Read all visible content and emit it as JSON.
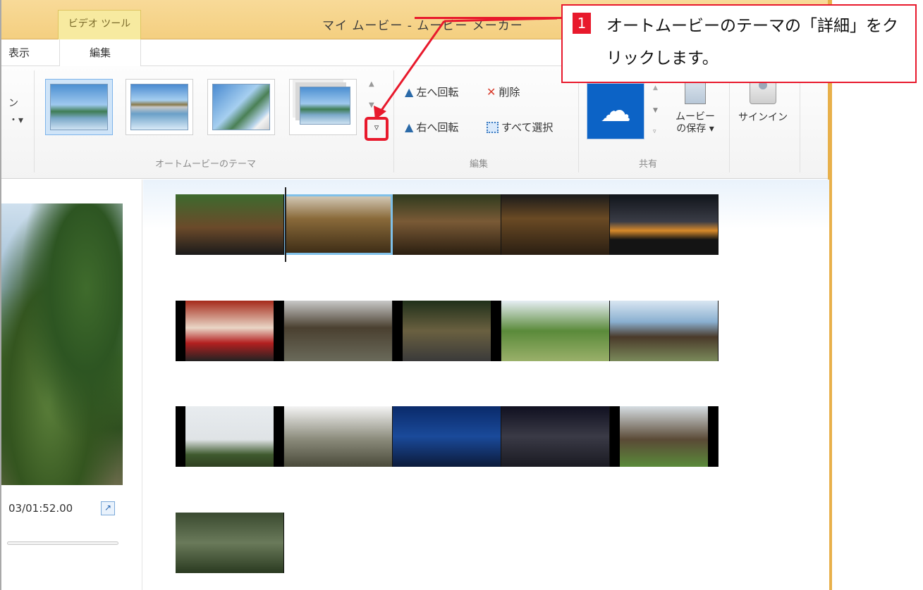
{
  "titlebar": {
    "contextual_tab": "ビデオ ツール",
    "title": "マイ ムービー - ムービー メーカー"
  },
  "tabs": {
    "view": "表示",
    "edit": "編集"
  },
  "ribbon": {
    "left_stub_top": "ン",
    "left_stub_bottom": "・▾",
    "themes_group_label": "オートムービーのテーマ",
    "edit_group_label": "編集",
    "share_group_label": "共有",
    "more_glyph": "▿",
    "scroll_up_glyph": "▲",
    "scroll_down_glyph": "▼",
    "rotate_left": "左へ回転",
    "rotate_right": "右へ回転",
    "delete": "削除",
    "select_all": "すべて選択",
    "save_movie_line1": "ムービー",
    "save_movie_line2": "の保存 ▾",
    "sign_in": "サインイン",
    "icons": {
      "rotate": "mountain-rotate-icon",
      "delete": "red-x-icon",
      "select_all": "dotted-selection-icon",
      "onedrive": "cloud-icon",
      "save": "save-movie-icon",
      "signin": "user-icon"
    }
  },
  "preview": {
    "time": "03/01:52.00",
    "fullscreen_glyph": "↗"
  },
  "callout": {
    "number": "1",
    "text": "オートムービーのテーマの「詳細」をクリックします。",
    "accent_color": "#e8192c"
  },
  "colors": {
    "titlebar": "#f4cf80",
    "window_border": "#e8b04a",
    "onedrive_blue": "#0c63c6",
    "selection": "#7fc0e8"
  }
}
